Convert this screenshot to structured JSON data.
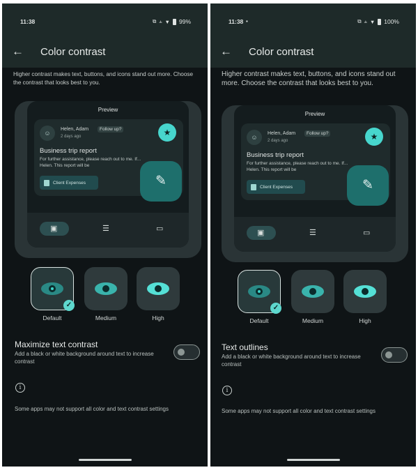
{
  "left": {
    "status": {
      "time": "11:38",
      "battery": "99%"
    },
    "title": "Color contrast",
    "subtitle": "Higher contrast makes text, buttons, and icons stand out more. Choose the contrast that looks best to you.",
    "preview": {
      "label": "Preview",
      "sender": "Helen, Adam",
      "chip": "Follow up?",
      "date": "2 days ago",
      "subject": "Business trip report",
      "snippet_line1": "For further assistance, please reach out to me. If...",
      "snippet_line2": "Helen. This report will be",
      "attachment": "Client Expenses"
    },
    "contrast_options": [
      "Default",
      "Medium",
      "High"
    ],
    "selected_contrast": "Default",
    "setting_title": "Maximize text contrast",
    "setting_desc": "Add a black or white background around text to increase contrast",
    "toggle_on": false,
    "footnote": "Some apps may not support all color and text contrast settings"
  },
  "right": {
    "status": {
      "time": "11:38",
      "battery": "100%"
    },
    "title": "Color contrast",
    "subtitle": "Higher contrast makes text, buttons, and icons stand out more. Choose the contrast that looks best to you.",
    "preview": {
      "label": "Preview",
      "sender": "Helen, Adam",
      "chip": "Follow up?",
      "date": "2 days ago",
      "subject": "Business trip report",
      "snippet_line1": "For further assistance, please reach out to me. If...",
      "snippet_line2": "Helen. This report will be",
      "attachment": "Client Expenses"
    },
    "contrast_options": [
      "Default",
      "Medium",
      "High"
    ],
    "selected_contrast": "Default",
    "setting_title": "Text outlines",
    "setting_desc": "Add a black or white background around text to increase contrast",
    "toggle_on": false,
    "footnote": "Some apps may not support all color and text contrast settings"
  },
  "icons": {
    "back": "arrow-left-icon",
    "wifi": "wifi-icon",
    "star": "star-icon",
    "edit": "pencil-icon",
    "inbox": "inbox-icon",
    "article": "article-icon",
    "chat": "chat-icon",
    "eye": "eye-icon",
    "check": "check-icon",
    "info": "info-icon"
  },
  "colors": {
    "background": "#0f1416",
    "appbar": "#1e2a29",
    "accent": "#47d6cd",
    "fab": "#1e6f6c"
  }
}
